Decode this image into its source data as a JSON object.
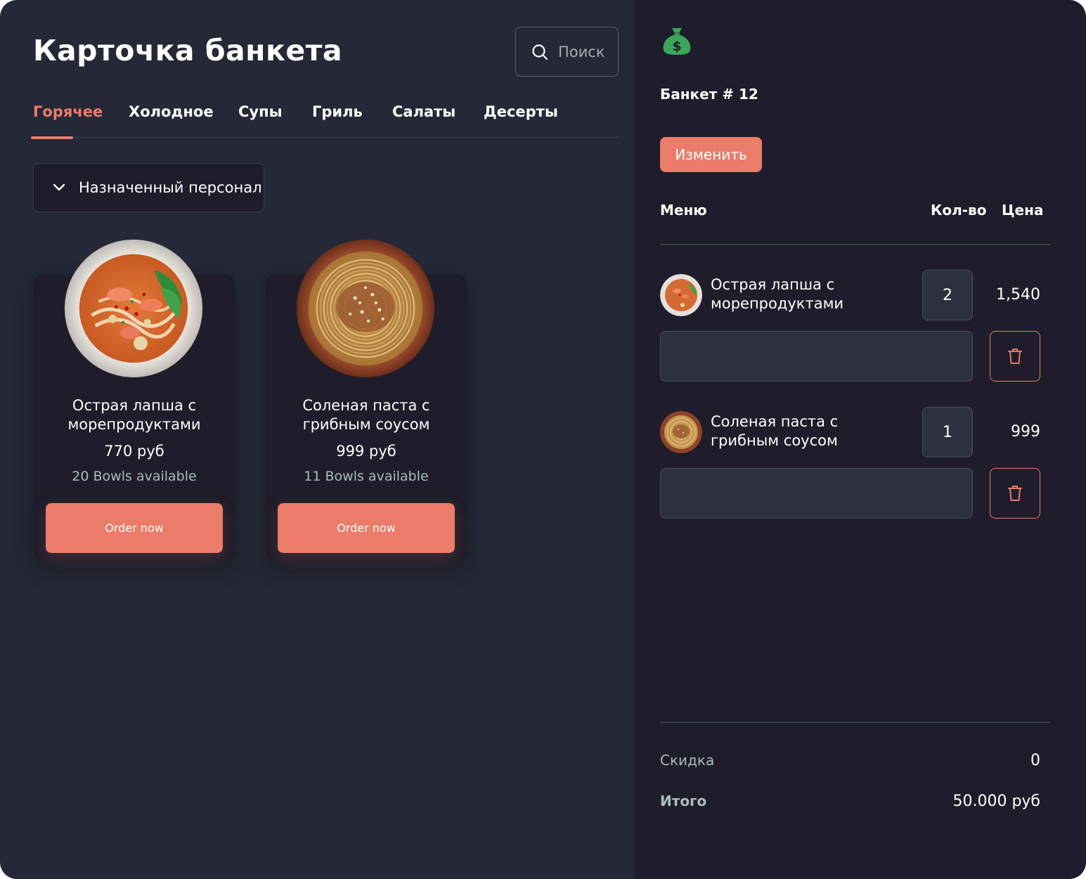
{
  "header": {
    "title": "Карточка банкета",
    "search_placeholder": "Поиск"
  },
  "tabs": [
    {
      "label": "Горячее",
      "active": true
    },
    {
      "label": "Холодное"
    },
    {
      "label": "Супы"
    },
    {
      "label": "Гриль"
    },
    {
      "label": "Салаты"
    },
    {
      "label": "Десерты"
    }
  ],
  "staff_dropdown": {
    "label": "Назначенный персонал"
  },
  "dishes": [
    {
      "name": "Острая лапша с морепродуктами",
      "price": "770 руб",
      "availability": "20 Bowls available",
      "button": "Order now"
    },
    {
      "name": "Соленая паста с грибным соусом",
      "price": "999 руб",
      "availability": "11 Bowls available",
      "button": "Order now"
    }
  ],
  "order": {
    "icon": "money-bag-icon",
    "title": "Банкет # 12",
    "edit_button": "Изменить",
    "columns": {
      "menu": "Меню",
      "qty": "Кол-во",
      "price": "Цена"
    },
    "items": [
      {
        "name": "Острая лапша с морепродуктами",
        "qty": "2",
        "price": "1,540"
      },
      {
        "name": "Соленая паста с грибным соусом",
        "qty": "1",
        "price": "999"
      }
    ],
    "discount_label": "Скидка",
    "discount_value": "0",
    "total_label": "Итого",
    "total_value": "50.000 руб"
  },
  "colors": {
    "accent": "#ea7c69",
    "background": "#252836",
    "panel": "#1f1d2b",
    "bag_green": "#3aa657"
  }
}
